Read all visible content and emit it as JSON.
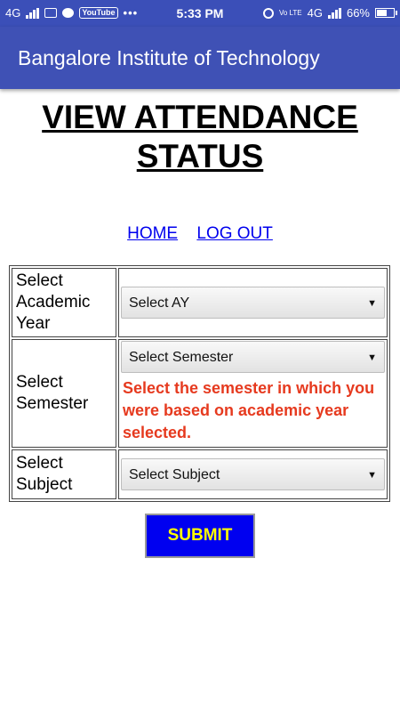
{
  "status_bar": {
    "network_left": "4G",
    "youtube": "YouTube",
    "more": "•••",
    "time": "5:33 PM",
    "volte": "Vo LTE",
    "network_right": "4G",
    "battery": "66%",
    "battery_level": 0.66
  },
  "appbar": {
    "title": "Bangalore Institute of Technology",
    "color": "#3f51b5"
  },
  "page": {
    "heading": "VIEW ATTENDANCE STATUS"
  },
  "nav": {
    "home": "HOME",
    "logout": "LOG OUT"
  },
  "form": {
    "academic_year": {
      "label": "Select Academic Year",
      "value": "Select AY"
    },
    "semester": {
      "label": "Select Semester",
      "value": "Select Semester",
      "note": "Select the semester in which you were based on academic year selected."
    },
    "subject": {
      "label": "Select Subject",
      "value": "Select Subject"
    },
    "submit": "SUBMIT"
  },
  "colors": {
    "note": "#e63a1f",
    "submit_bg": "#0000f0",
    "submit_text": "#ffff00",
    "link": "#0000ee"
  }
}
